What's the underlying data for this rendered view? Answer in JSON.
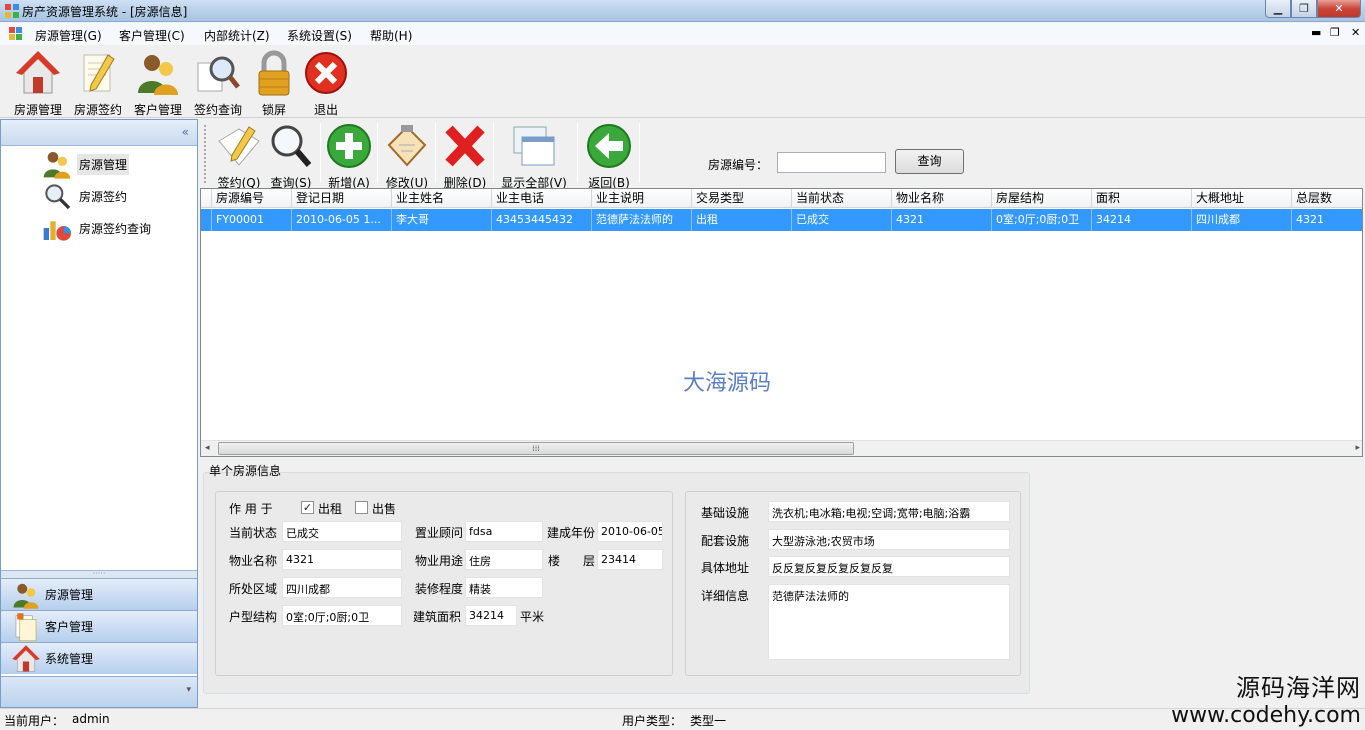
{
  "window": {
    "title": "房产资源管理系统 - [房源信息]"
  },
  "menu": [
    "房源管理(G)",
    "客户管理(C)",
    "内部统计(Z)",
    "系统设置(S)",
    "帮助(H)"
  ],
  "main_toolbar": [
    {
      "label": "房源管理",
      "icon": "house-icon"
    },
    {
      "label": "房源签约",
      "icon": "pencil-note-icon"
    },
    {
      "label": "客户管理",
      "icon": "users-icon"
    },
    {
      "label": "签约查询",
      "icon": "magnifier-icon"
    },
    {
      "label": "锁屏",
      "icon": "lock-icon"
    },
    {
      "label": "退出",
      "icon": "close-icon"
    }
  ],
  "tree": [
    {
      "label": "房源管理",
      "icon": "users-icon"
    },
    {
      "label": "房源签约",
      "icon": "magnifier-icon"
    },
    {
      "label": "房源签约查询",
      "icon": "chart-icon"
    }
  ],
  "nav_buttons": [
    {
      "label": "房源管理",
      "icon": "users-icon"
    },
    {
      "label": "客户管理",
      "icon": "document-icon"
    },
    {
      "label": "系统管理",
      "icon": "house-icon"
    }
  ],
  "sub_toolbar": [
    {
      "label": "签约(Q)",
      "icon": "sign-icon"
    },
    {
      "label": "查询(S)",
      "icon": "magnifier-icon"
    },
    {
      "label": "新增(A)",
      "icon": "add-icon"
    },
    {
      "label": "修改(U)",
      "icon": "clipboard-icon"
    },
    {
      "label": "删除(D)",
      "icon": "delete-icon"
    },
    {
      "label": "显示全部(V)",
      "icon": "windows-icon"
    },
    {
      "label": "返回(B)",
      "icon": "back-arrow-icon"
    }
  ],
  "search": {
    "label": "房源编号：",
    "value": "",
    "button": "查询"
  },
  "grid": {
    "columns": [
      "房源编号",
      "登记日期",
      "业主姓名",
      "业主电话",
      "业主说明",
      "交易类型",
      "当前状态",
      "物业名称",
      "房屋结构",
      "面积",
      "大概地址",
      "总层数"
    ],
    "rows": [
      [
        "FY00001",
        "2010-06-05 1...",
        "李大哥",
        "43453445432",
        "范德萨法法师的",
        "出租",
        "已成交",
        "4321",
        "0室;0厅;0厨;0卫",
        "34214",
        "四川成都",
        "4321"
      ]
    ],
    "watermark": "大海源码"
  },
  "detail": {
    "title": "单个房源信息",
    "usage_label": "作 用 于",
    "rent_label": "出租",
    "rent_checked": true,
    "sale_label": "出售",
    "sale_checked": false,
    "status_label": "当前状态",
    "status_value": "已成交",
    "agent_label": "置业顾问",
    "agent_value": "fdsa",
    "built_year_label": "建成年份",
    "built_year_value": "2010-06-05",
    "property_label": "物业名称",
    "property_value": "4321",
    "purpose_label": "物业用途",
    "purpose_value": "住房",
    "building_label": "楼",
    "floor_label": "层",
    "floor_value": "23414",
    "district_label": "所处区域",
    "district_value": "四川成都",
    "decor_label": "装修程度",
    "decor_value": "精装",
    "layout_label": "户型结构",
    "layout_value": "0室;0厅;0厨;0卫",
    "area_label": "建筑面积",
    "area_value": "34214",
    "area_unit": "平米",
    "facility_label": "基础设施",
    "facility_value": "洗衣机;电冰箱;电视;空调;宽带;电脑;浴霸",
    "support_label": "配套设施",
    "support_value": "大型游泳池;农贸市场",
    "address_label": "具体地址",
    "address_value": "反反复反复反复反复反复",
    "info_label": "详细信息",
    "info_value": "范德萨法法师的"
  },
  "status": {
    "user_label": "当前用户：",
    "user_value": "admin",
    "type_label": "用户类型：",
    "type_value": "类型一"
  },
  "corner_watermark": {
    "line1": "源码海洋网",
    "line2": "www.codehy.com"
  }
}
